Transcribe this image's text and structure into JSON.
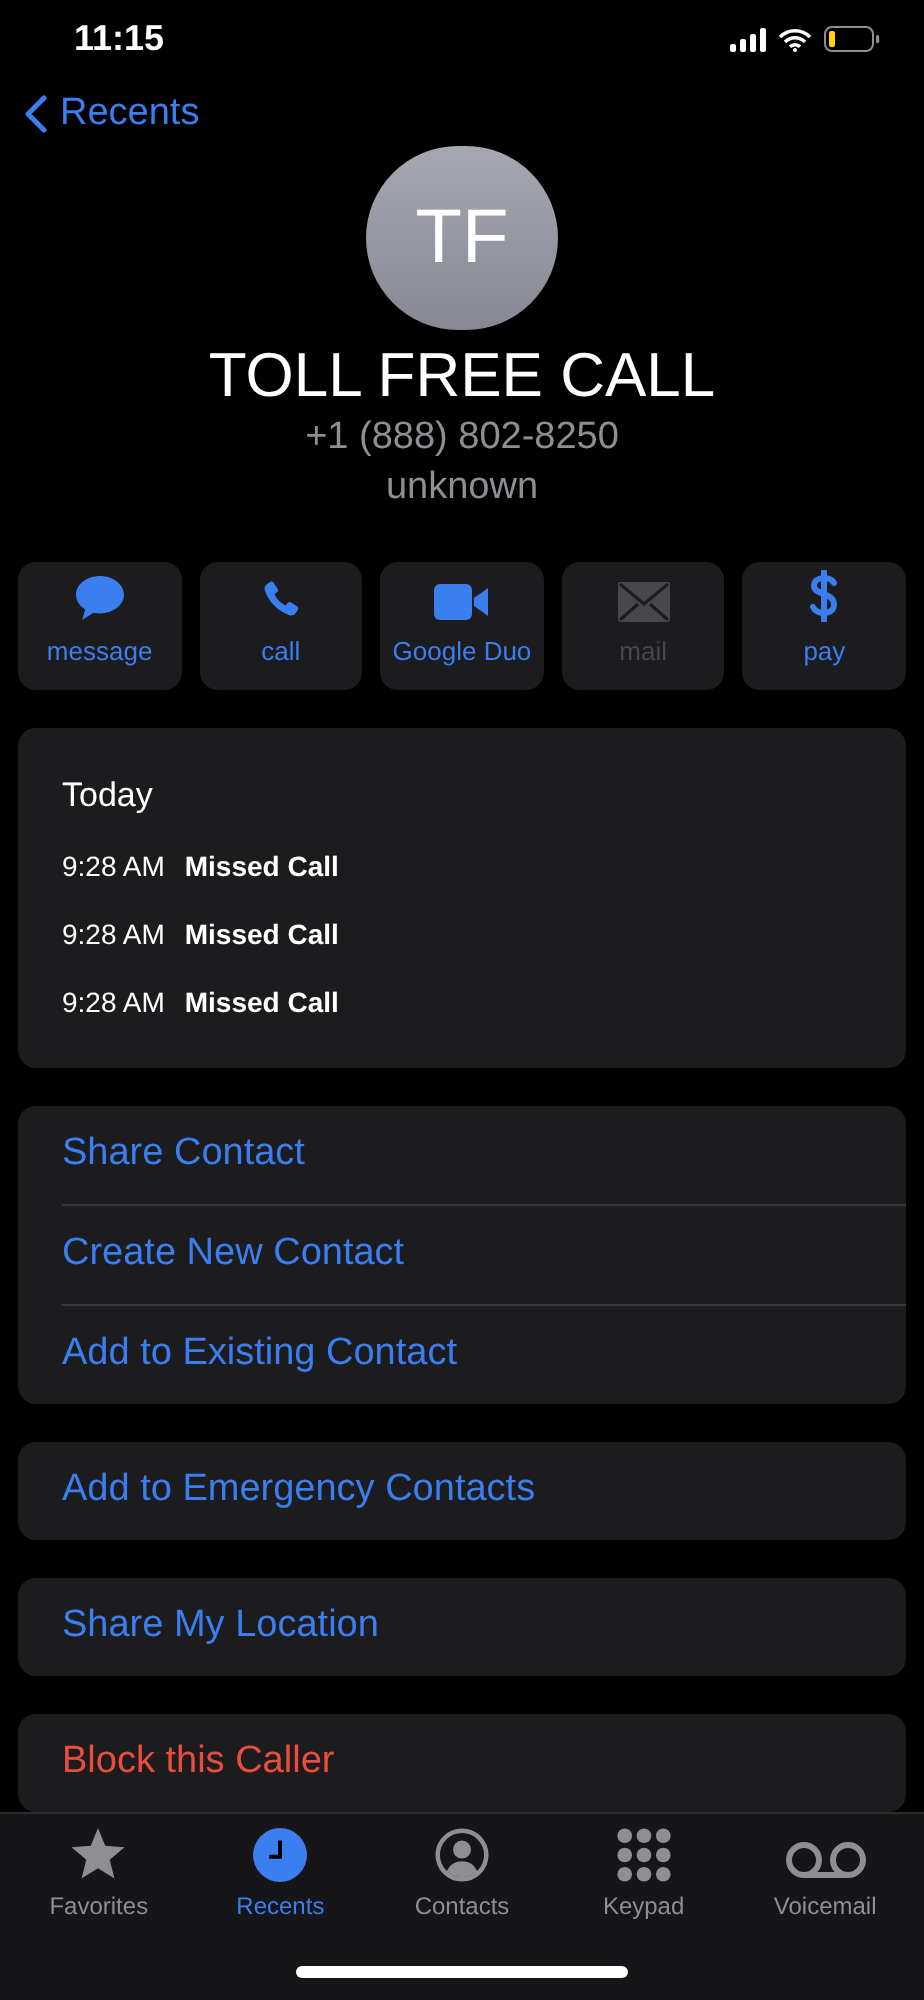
{
  "status_bar": {
    "time": "11:15"
  },
  "nav": {
    "back_label": "Recents"
  },
  "contact": {
    "initials": "TF",
    "name": "TOLL FREE CALL",
    "phone": "+1 (888) 802-8250",
    "label": "unknown"
  },
  "actions": [
    {
      "kind": "message",
      "label": "message",
      "disabled": false
    },
    {
      "kind": "call",
      "label": "call",
      "disabled": false
    },
    {
      "kind": "video",
      "label": "Google Duo",
      "disabled": false
    },
    {
      "kind": "mail",
      "label": "mail",
      "disabled": true
    },
    {
      "kind": "pay",
      "label": "pay",
      "disabled": false
    }
  ],
  "call_log": {
    "day": "Today",
    "entries": [
      {
        "time": "9:28 AM",
        "type": "Missed Call"
      },
      {
        "time": "9:28 AM",
        "type": "Missed Call"
      },
      {
        "time": "9:28 AM",
        "type": "Missed Call"
      }
    ]
  },
  "option_groups": [
    [
      {
        "label": "Share Contact",
        "kind": "normal"
      },
      {
        "label": "Create New Contact",
        "kind": "normal"
      },
      {
        "label": "Add to Existing Contact",
        "kind": "normal"
      }
    ],
    [
      {
        "label": "Add to Emergency Contacts",
        "kind": "normal"
      }
    ],
    [
      {
        "label": "Share My Location",
        "kind": "normal"
      }
    ],
    [
      {
        "label": "Block this Caller",
        "kind": "destructive"
      }
    ]
  ],
  "tab_bar": [
    {
      "kind": "favorites",
      "label": "Favorites",
      "selected": false
    },
    {
      "kind": "recents",
      "label": "Recents",
      "selected": true
    },
    {
      "kind": "contacts",
      "label": "Contacts",
      "selected": false
    },
    {
      "kind": "keypad",
      "label": "Keypad",
      "selected": false
    },
    {
      "kind": "voicemail",
      "label": "Voicemail",
      "selected": false
    }
  ]
}
